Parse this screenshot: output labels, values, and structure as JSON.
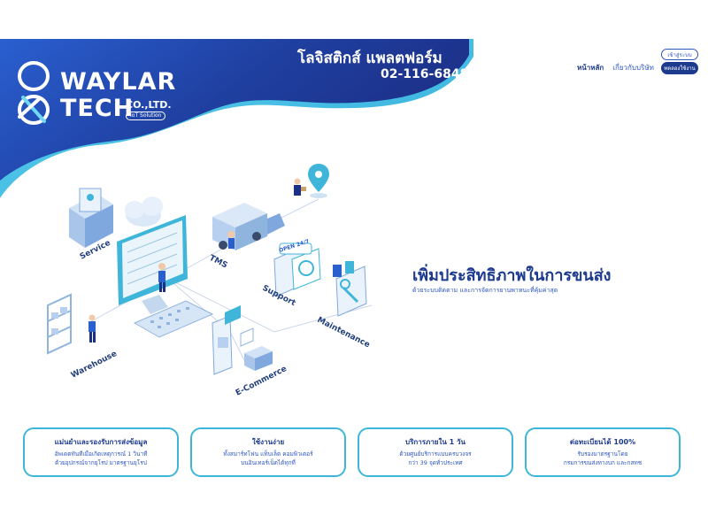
{
  "colors": {
    "brand_dark": "#1c3a8e",
    "brand_mid": "#2d56c2",
    "accent_cyan": "#3fb6d9"
  },
  "logo": {
    "word_line1": "WAYLAR",
    "word_line2": "TECH",
    "co": "CO.,LTD.",
    "tagline": "IoT Solution"
  },
  "header": {
    "title": "โลจิสติกส์ แพลตฟอร์ม",
    "phone": "02-116-6848"
  },
  "nav": {
    "home": "หน้าหลัก",
    "about": "เกี่ยวกับบริษัท",
    "login": "เข้าสู่ระบบ",
    "trial": "ทดลองใช้งาน"
  },
  "illustration": {
    "labels": {
      "service": "Service",
      "tms": "TMS",
      "support": "Support",
      "maintenance": "Maintenance",
      "warehouse": "Warehouse",
      "ecommerce": "E-Commerce",
      "open247": "OPEN 24/7"
    }
  },
  "hero": {
    "title": "เพิ่มประสิทธิภาพในการขนส่ง",
    "subtitle": "ด้วยระบบติดตาม และการจัดการยานพาหนะที่คุ้มค่าสุด"
  },
  "features": [
    {
      "title": "แม่นยำและรองรับการส่งข้อมูล",
      "desc1": "อัพเดตทันทีเมื่อเกิดเหตุการณ์ 1 วินาที",
      "desc2": "ด้วยอุปกรณ์จากยุโรป มาตรฐานยุโรป"
    },
    {
      "title": "ใช้งานง่าย",
      "desc1": "ทั้งสมาร์ทโฟน แท็บเล็ต คอมพิวเตอร์",
      "desc2": "บนอินเทอร์เน็ตได้ทุกที่"
    },
    {
      "title": "บริการภายใน 1 วัน",
      "desc1": "ด้วยศูนย์บริการแบบครบวงจร",
      "desc2": "กว่า 39 จุดทั่วประเทศ"
    },
    {
      "title": "ต่อทะเบียนได้ 100%",
      "desc1": "รับรองมาตรฐานโดย",
      "desc2": "กรมการขนส่งทางบก และกสทช"
    }
  ]
}
